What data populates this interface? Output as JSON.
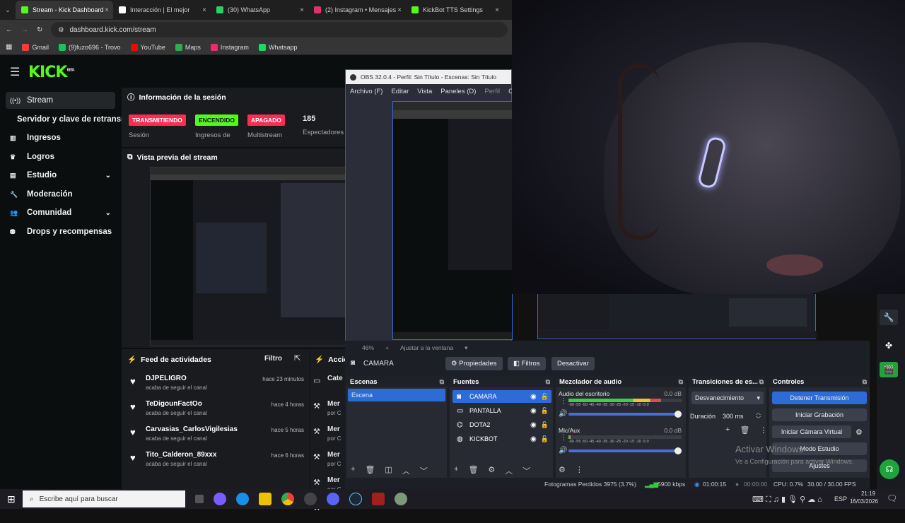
{
  "browser": {
    "tabs": [
      {
        "label": "Stream - Kick Dashboard",
        "color": "#53fc18",
        "active": true
      },
      {
        "label": "Interacción | El mejor",
        "color": "#ffffff",
        "active": false
      },
      {
        "label": "(30) WhatsApp",
        "color": "#25d366",
        "active": false
      },
      {
        "label": "(2) Instagram • Mensajes",
        "color": "#e1306c",
        "active": false
      },
      {
        "label": "KickBot TTS Settings",
        "color": "#53fc18",
        "active": false
      }
    ],
    "url": "dashboard.kick.com/stream",
    "bookmarks": [
      "Gmail",
      "(9)fuzo696 - Trovo",
      "YouTube",
      "Maps",
      "Instagram",
      "Whatsapp"
    ]
  },
  "kick": {
    "logo": "KICK",
    "logo_sup": "BETA",
    "sidebar": [
      {
        "label": "Stream",
        "icon": "broadcast-icon",
        "active": true,
        "chevron": false
      },
      {
        "label": "Servidor y clave de retransmi",
        "icon": "",
        "active": false,
        "chevron": false
      },
      {
        "label": "Ingresos",
        "icon": "chart-icon",
        "active": false,
        "chevron": false
      },
      {
        "label": "Logros",
        "icon": "trophy-icon",
        "active": false,
        "chevron": false
      },
      {
        "label": "Estudio",
        "icon": "studio-icon",
        "active": false,
        "chevron": true
      },
      {
        "label": "Moderación",
        "icon": "wrench-icon",
        "active": false,
        "chevron": false
      },
      {
        "label": "Comunidad",
        "icon": "people-icon",
        "active": false,
        "chevron": true
      },
      {
        "label": "Drops y recompensas",
        "icon": "gift-icon",
        "active": false,
        "chevron": false
      }
    ],
    "session": {
      "title": "Información de la sesión",
      "badges": [
        {
          "label": "TRANSMITIENDO",
          "sub": "Sesión",
          "bg": "#ff2d55",
          "fg": "#ffffff"
        },
        {
          "label": "ENCENDIDO",
          "sub": "Ingresos de Sesión",
          "bg": "#53fc18",
          "fg": "#0b0e0f"
        },
        {
          "label": "APAGADO",
          "sub": "Multistream",
          "bg": "#ff2d55",
          "fg": "#ffffff"
        }
      ],
      "viewers": "185",
      "viewers_label": "Espectadores"
    },
    "preview_title": "Vista previa del stream",
    "feed": {
      "title": "Feed de actividades",
      "filter": "Filtro",
      "items": [
        {
          "name": "DJPELIGRO",
          "sub": "acaba de seguir el canal",
          "time": "hace 23 minutos"
        },
        {
          "name": "TeDigounFactOo",
          "sub": "acaba de seguir el canal",
          "time": "hace 4 horas"
        },
        {
          "name": "Carvasias_CarlosVigilesias",
          "sub": "acaba de seguir el canal",
          "time": "hace 5 horas"
        },
        {
          "name": "Tito_Calderon_89xxx",
          "sub": "acaba de seguir el canal",
          "time": "hace 6 horas"
        }
      ]
    },
    "actions": {
      "title": "Accion",
      "items": [
        "Cate",
        "Mer",
        "Mer",
        "Mer",
        "Mer",
        "Mer"
      ],
      "subs": [
        "",
        "por C",
        "por C",
        "por C",
        "por C",
        ""
      ]
    }
  },
  "obs": {
    "title": "OBS 32.0.4 - Perfil: Sin Título - Escenas: Sin Título",
    "menu": [
      "Archivo (F)",
      "Editar",
      "Vista",
      "Paneles (D)",
      "Perfil",
      "Colección"
    ],
    "zoom": "46%",
    "fit": "Ajustar a la ventana",
    "source_selected": "CAMARA",
    "source_buttons": [
      "Propiedades",
      "Filtros",
      "Desactivar"
    ],
    "scenes": {
      "title": "Escenas",
      "items": [
        "Escena"
      ]
    },
    "sources": {
      "title": "Fuentes",
      "items": [
        {
          "label": "CAMARA",
          "icon": "camera-icon"
        },
        {
          "label": "PANTALLA",
          "icon": "monitor-icon"
        },
        {
          "label": "DOTA2",
          "icon": "gamepad-icon"
        },
        {
          "label": "KICKBOT",
          "icon": "globe-icon"
        }
      ]
    },
    "mixer": {
      "title": "Mezclador de audio",
      "channels": [
        {
          "label": "Audio del escritorio",
          "db": "0.0 dB",
          "level": 0.82
        },
        {
          "label": "Mic/Aux",
          "db": "0.0 dB",
          "level": 0.02
        }
      ],
      "ticks": "-60 -55 -50 -45 -40 -35 -30 -25 -20 -15 -10 -5 0"
    },
    "transitions": {
      "title": "Transiciones de es...",
      "value": "Desvanecimiento",
      "duration_label": "Duración",
      "duration": "300 ms"
    },
    "controls": {
      "title": "Controles",
      "buttons": [
        "Detener Transmisión",
        "Iniciar Grabación",
        "Iniciar Cámara Virtual",
        "Modo Estudio",
        "Ajustes"
      ]
    },
    "status": {
      "dropped": "Fotogramas Perdidos 3975 (3.7%)",
      "bitrate": "5900 kbps",
      "live": "01:00:15",
      "rec": "00:00:00",
      "cpu": "CPU: 0.7%",
      "fps": "30.00 / 30.00 FPS"
    }
  },
  "watermark": {
    "line1": "Activar Windows",
    "line2": "Ve a Configuración para activar Windows."
  },
  "taskbar": {
    "search_placeholder": "Escribe aquí para buscar",
    "time": "21:19",
    "date": "16/03/2026",
    "lang": "ESP"
  }
}
